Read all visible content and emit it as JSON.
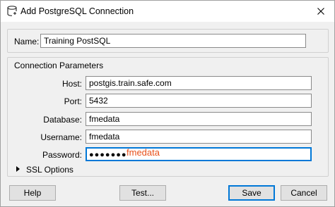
{
  "window": {
    "title": "Add PostgreSQL Connection"
  },
  "name_section": {
    "label": "Name:",
    "value": "Training PostSQL"
  },
  "connection": {
    "group_title": "Connection Parameters",
    "host_label": "Host:",
    "host_value": "postgis.train.safe.com",
    "port_label": "Port:",
    "port_value": "5432",
    "database_label": "Database:",
    "database_value": "fmedata",
    "username_label": "Username:",
    "username_value": "fmedata",
    "password_label": "Password:",
    "password_masked": "●●●●●●●",
    "password_hint": "fmedata"
  },
  "ssl": {
    "label": "SSL Options"
  },
  "buttons": {
    "help": "Help",
    "test": "Test...",
    "save": "Save",
    "cancel": "Cancel"
  },
  "colors": {
    "accent": "#0078d7",
    "hint": "#e8501a"
  }
}
